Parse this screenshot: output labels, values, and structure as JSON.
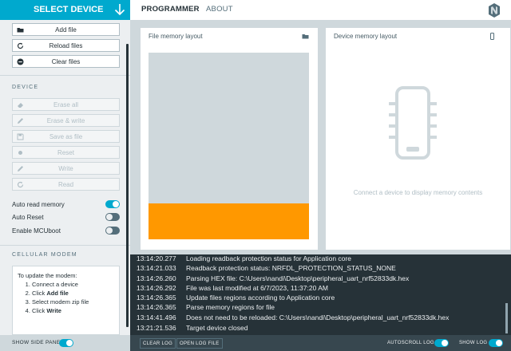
{
  "colors": {
    "accent": "#00a9ce",
    "orange": "#ff9800",
    "dark": "#263238"
  },
  "header": {
    "select_device": "SELECT DEVICE",
    "tabs": [
      "PROGRAMMER",
      "ABOUT"
    ],
    "active_tab": "PROGRAMMER",
    "logo_icon": "nordic-logo-icon"
  },
  "sidebar": {
    "file_buttons": [
      {
        "label": "Add file",
        "icon": "folder-icon"
      },
      {
        "label": "Reload files",
        "icon": "reload-icon"
      },
      {
        "label": "Clear files",
        "icon": "minus-circle-icon"
      }
    ],
    "device_title": "DEVICE",
    "device_buttons": [
      {
        "label": "Erase all",
        "icon": "eraser-icon"
      },
      {
        "label": "Erase & write",
        "icon": "pencil-icon"
      },
      {
        "label": "Save as file",
        "icon": "save-icon"
      },
      {
        "label": "Reset",
        "icon": "dot-icon"
      },
      {
        "label": "Write",
        "icon": "pencil-icon"
      },
      {
        "label": "Read",
        "icon": "refresh-icon"
      }
    ],
    "toggles": [
      {
        "label": "Auto read memory",
        "on": true
      },
      {
        "label": "Auto Reset",
        "on": false
      },
      {
        "label": "Enable MCUboot",
        "on": false
      }
    ],
    "cellular_title": "CELLULAR MODEM",
    "modem": {
      "intro": "To update the modem:",
      "step1": "Connect a device",
      "step2_pre": "Click ",
      "step2_bold": "Add file",
      "step3": "Select modem zip file",
      "step4_pre": "Click ",
      "step4_bold": "Write"
    },
    "show_side_panel": "SHOW SIDE PANEL"
  },
  "file_panel": {
    "title": "File memory layout",
    "icon": "folder-icon"
  },
  "device_panel": {
    "title": "Device memory layout",
    "icon": "phone-icon",
    "hint": "Connect a device to display memory contents"
  },
  "log": [
    {
      "time": "13:14:20.277",
      "msg": "Loading readback protection status for Application core"
    },
    {
      "time": "13:14:21.033",
      "msg": "Readback protection status: NRFDL_PROTECTION_STATUS_NONE"
    },
    {
      "time": "13:14:26.260",
      "msg": "Parsing HEX file: C:\\Users\\nandi\\Desktop\\peripheral_uart_nrf52833dk.hex"
    },
    {
      "time": "13:14:26.292",
      "msg": "File was last modified at 6/7/2023, 11:37:20 AM"
    },
    {
      "time": "13:14:26.365",
      "msg": "Update files regions according to Application core"
    },
    {
      "time": "13:14:26.365",
      "msg": "Parse memory regions for file"
    },
    {
      "time": "13:14:41.496",
      "msg": "Does not need to be reloaded: C:\\Users\\nandi\\Desktop\\peripheral_uart_nrf52833dk.hex"
    },
    {
      "time": "13:21:21.536",
      "msg": "Target device closed"
    }
  ],
  "bottom": {
    "clear_log": "CLEAR LOG",
    "open_log_file": "OPEN LOG FILE",
    "autoscroll_log": "AUTOSCROLL LOG",
    "show_log": "SHOW LOG"
  }
}
